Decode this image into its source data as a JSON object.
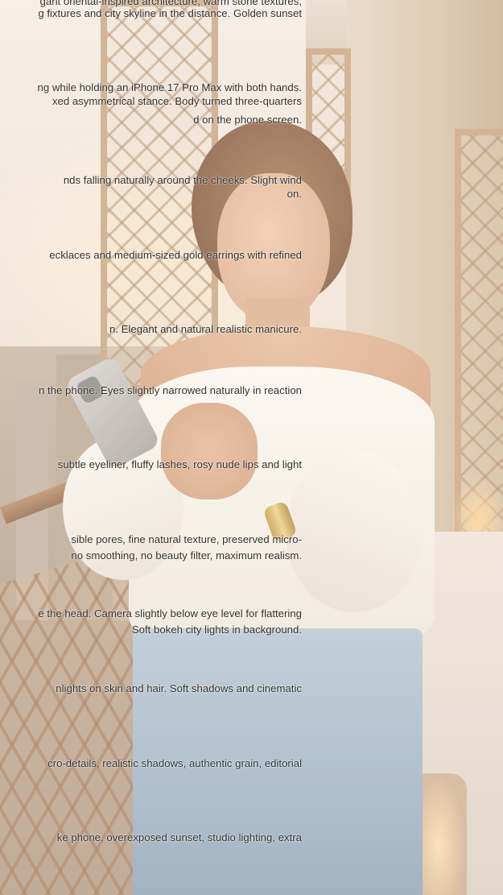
{
  "image": {
    "subject": "woman-with-phone-balcony-sunset",
    "overlay_lines": [
      "gant oriental-inspired architecture, warm stone textures,",
      "g fixtures and city skyline in the distance. Golden sunset",
      "ng while holding an iPhone 17 Pro Max with both hands.",
      "xed asymmetrical stance. Body turned three-quarters",
      "d on the phone screen.",
      "nds falling naturally around the cheeks. Slight wind",
      "on.",
      "ecklaces and medium-sized gold earrings with refined",
      "n. Elegant and natural realistic manicure.",
      "n the phone. Eyes slightly narrowed naturally in reaction",
      "subtle eyeliner, fluffy lashes, rosy nude lips and light",
      "sible pores, fine natural texture, preserved micro-",
      "no smoothing, no beauty filter, maximum realism.",
      "e the head. Camera slightly below eye level for flattering",
      "Soft bokeh city lights in background.",
      "nlights on skin and hair. Soft shadows and cinematic",
      "cro-details, realistic shadows, authentic grain, editorial",
      "ke phone, overexposed sunset, studio lighting, extra"
    ]
  },
  "colors": {
    "text": "#34302c",
    "blouse": "#fbf7f1",
    "jeans": "#a9bccd",
    "wood": "#c9a682"
  }
}
